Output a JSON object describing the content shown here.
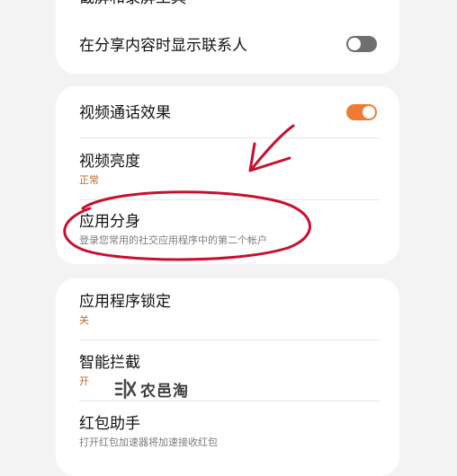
{
  "settings": {
    "card1": {
      "cut_off_title": "截屏和录屏工具",
      "show_contacts_label": "在分享内容时显示联系人",
      "show_contacts_on": false
    },
    "card2": {
      "video_call_effects_label": "视频通话效果",
      "video_call_effects_on": true,
      "video_brightness_label": "视频亮度",
      "video_brightness_value": "正常",
      "dual_messenger_label": "应用分身",
      "dual_messenger_desc": "登录您常用的社交应用程序中的第二个帐户"
    },
    "card3": {
      "app_lock_label": "应用程序锁定",
      "app_lock_value": "关",
      "smart_block_label": "智能拦截",
      "smart_block_value": "开",
      "red_packet_label": "红包助手",
      "red_packet_desc": "打开红包加速器将加速接收红包"
    }
  },
  "colors": {
    "accent": "#ee7b32",
    "annotation_red": "#c8102e"
  },
  "watermark": {
    "text": "农邑淘"
  }
}
